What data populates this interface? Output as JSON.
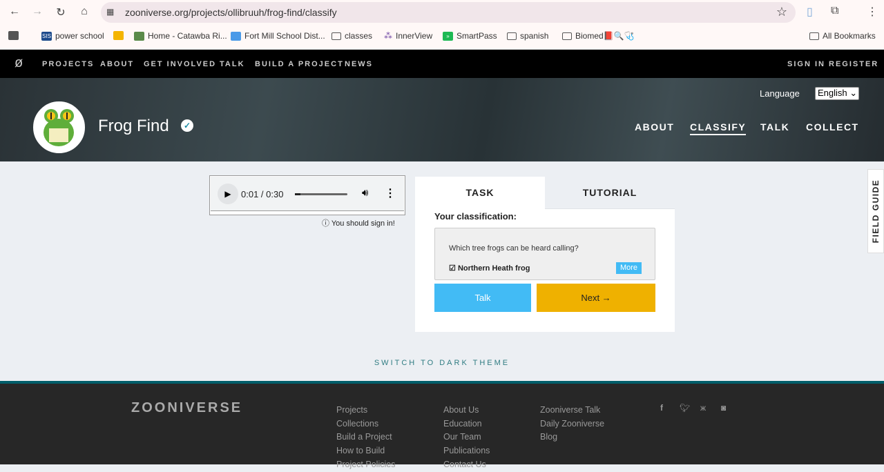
{
  "browser": {
    "url": "zooniverse.org/projects/ollibruuh/frog-find/classify",
    "bookmarks": [
      "power school",
      "Home - Catawba Ri...",
      "Fort Mill School Dist...",
      "classes",
      "InnerView",
      "SmartPass",
      "spanish",
      "Biomed📕🔍🩺"
    ],
    "all_bookmarks": "All Bookmarks"
  },
  "nav": {
    "items": [
      "PROJECTS",
      "ABOUT",
      "GET INVOLVED",
      "TALK",
      "BUILD A PROJECT",
      "NEWS"
    ],
    "sign_in": "SIGN IN",
    "register": "REGISTER"
  },
  "project": {
    "title": "Frog Find",
    "language_label": "Language",
    "language": "English",
    "nav": [
      "ABOUT",
      "CLASSIFY",
      "TALK",
      "COLLECT"
    ]
  },
  "audio": {
    "time": "0:01 / 0:30",
    "progress": 0.033
  },
  "signin_note": "You should sign in!",
  "task": {
    "tabs": [
      "TASK",
      "TUTORIAL"
    ],
    "heading": "Your classification:",
    "question": "Which tree frogs can be heard calling?",
    "answer": "Northern Heath frog",
    "more": "More",
    "talk": "Talk",
    "next": "Next →"
  },
  "field_guide": "FIELD GUIDE",
  "dark_theme": "SWITCH TO DARK THEME",
  "footer": {
    "logo": "ZOONIVERSE",
    "col1": [
      "Projects",
      "Collections",
      "Build a Project",
      "How to Build",
      "Project Policies"
    ],
    "col2": [
      "About Us",
      "Education",
      "Our Team",
      "Publications",
      "Contact Us"
    ],
    "col3": [
      "Zooniverse Talk",
      "Daily Zooniverse",
      "Blog"
    ]
  }
}
